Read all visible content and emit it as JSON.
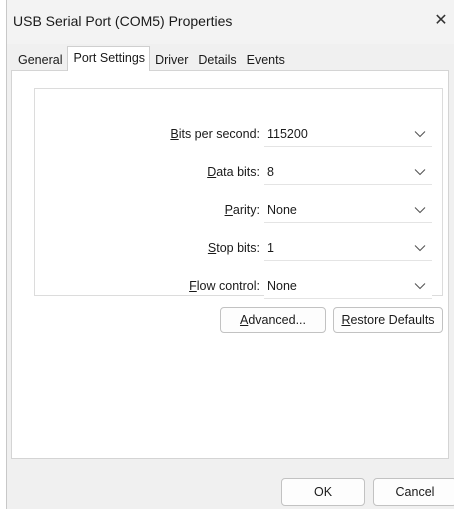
{
  "window": {
    "title": "USB Serial Port (COM5) Properties",
    "close_glyph": "✕"
  },
  "tabs": [
    {
      "label": "General"
    },
    {
      "label": "Port Settings",
      "active": true
    },
    {
      "label": "Driver"
    },
    {
      "label": "Details"
    },
    {
      "label": "Events"
    }
  ],
  "settings": {
    "bits_per_second": {
      "label_underlined": "B",
      "label_rest": "its per second:",
      "value": "115200"
    },
    "data_bits": {
      "label_plain": "",
      "label_underlined": "D",
      "label_rest": "ata bits:",
      "value": "8"
    },
    "parity": {
      "label_plain": "",
      "label_underlined": "P",
      "label_rest": "arity:",
      "value": "None"
    },
    "stop_bits": {
      "label_plain": "",
      "label_underlined": "S",
      "label_rest": "top bits:",
      "value": "1"
    },
    "flow_control": {
      "label_plain": "",
      "label_underlined": "F",
      "label_rest": "low control:",
      "value": "None"
    }
  },
  "buttons": {
    "advanced": {
      "underlined": "A",
      "rest": "dvanced..."
    },
    "restore": {
      "underlined": "R",
      "rest": "estore Defaults"
    },
    "ok": "OK",
    "cancel": "Cancel"
  },
  "icons": {
    "close": "close-icon",
    "dropdown": "chevron-down-icon"
  }
}
